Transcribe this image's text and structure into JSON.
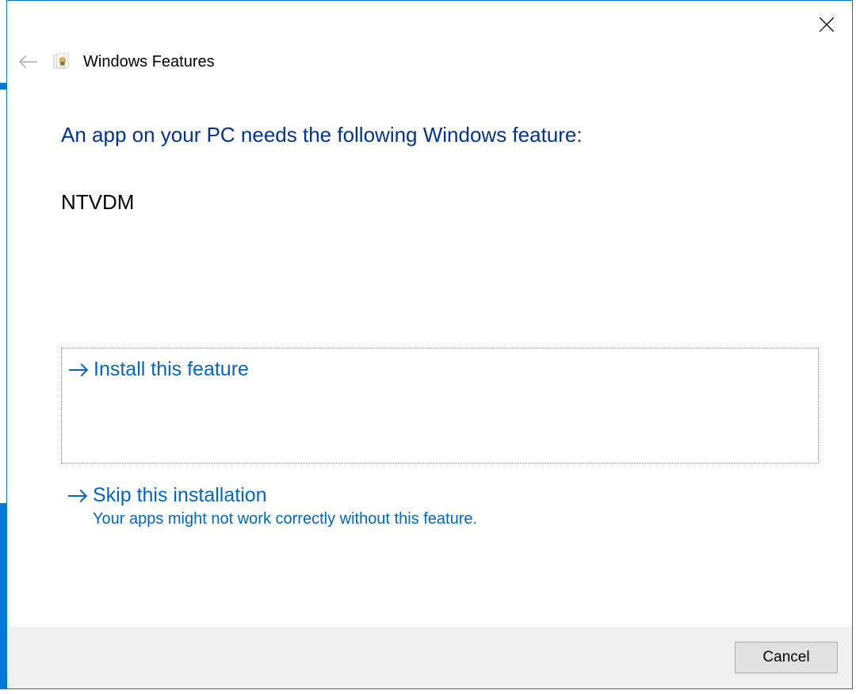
{
  "header": {
    "title": "Windows Features"
  },
  "main": {
    "heading": "An app on your PC needs the following Windows feature:",
    "feature_name": "NTVDM"
  },
  "options": {
    "install": {
      "title": "Install this feature"
    },
    "skip": {
      "title": "Skip this installation",
      "subtitle": "Your apps might not work correctly without this feature."
    }
  },
  "footer": {
    "cancel_label": "Cancel"
  }
}
